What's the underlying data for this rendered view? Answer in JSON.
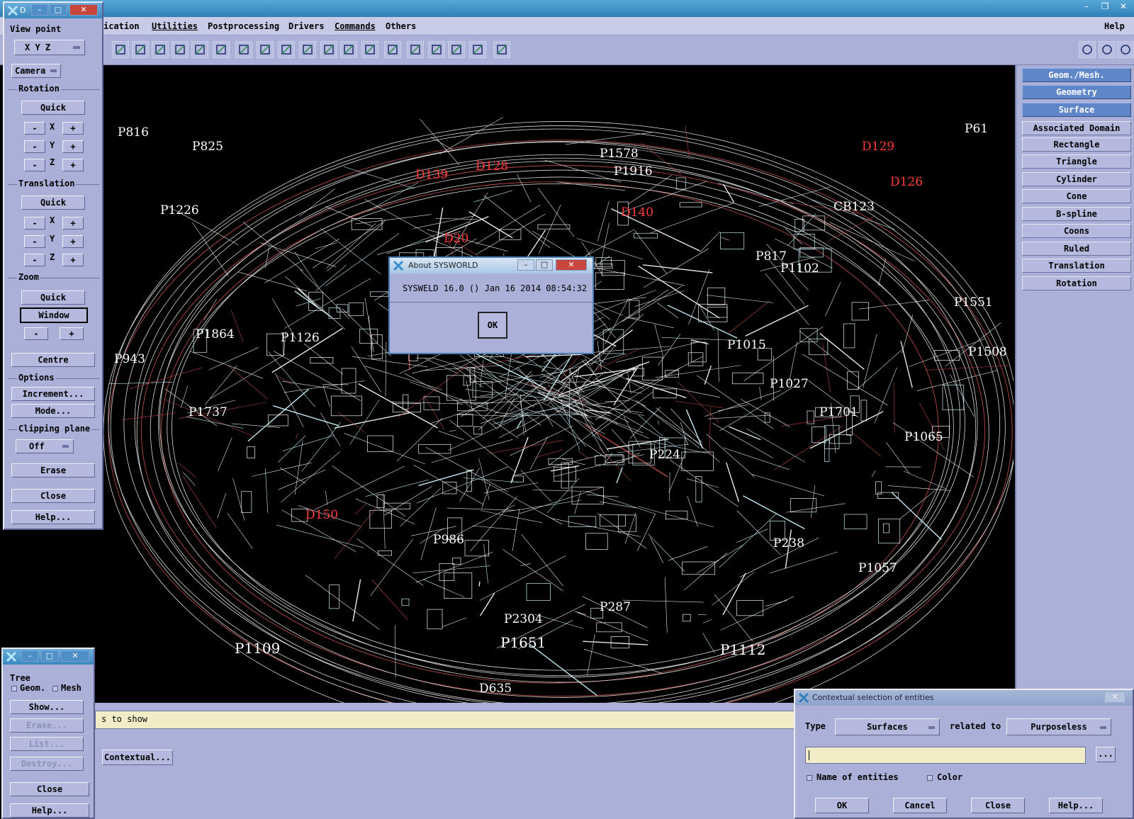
{
  "main_window": {
    "menus": [
      "ication",
      "Utilities",
      "Postprocessing",
      "Drivers",
      "Commands",
      "Others",
      "Help"
    ]
  },
  "view_dialog": {
    "title": "D",
    "view_point_label": "View point",
    "axis_select": "X  Y  Z",
    "camera_select": "Camera",
    "rotation_label": "Rotation",
    "quick_label": "Quick",
    "axis_x": "X",
    "axis_y": "Y",
    "axis_z": "Z",
    "minus": "-",
    "plus": "+",
    "translation_label": "Translation",
    "zoom_label": "Zoom",
    "window_label": "Window",
    "centre_label": "Centre",
    "options_label": "Options",
    "increment_label": "Increment...",
    "mode_label": "Mode...",
    "clipping_label": "Clipping plane",
    "clipping_value": "Off",
    "erase_label": "Erase",
    "close_label": "Close",
    "help_label": "Help..."
  },
  "right_panel": {
    "items": [
      {
        "label": "Geom./Mesh.",
        "selected": true
      },
      {
        "label": "Geometry",
        "selected": true
      },
      {
        "label": "Surface",
        "selected": true
      },
      {
        "label": "Associated Domain",
        "selected": false
      },
      {
        "label": "Rectangle",
        "selected": false
      },
      {
        "label": "Triangle",
        "selected": false
      },
      {
        "label": "Cylinder",
        "selected": false
      },
      {
        "label": "Cone",
        "selected": false
      },
      {
        "label": "B-spline",
        "selected": false
      },
      {
        "label": "Coons",
        "selected": false
      },
      {
        "label": "Ruled",
        "selected": false
      },
      {
        "label": "Translation",
        "selected": false
      },
      {
        "label": "Rotation",
        "selected": false
      }
    ]
  },
  "viewport_labels": [
    {
      "t": "P1109",
      "c": "#ffffff"
    },
    {
      "t": "P1651",
      "c": "#ffffff"
    },
    {
      "t": "P1112",
      "c": "#ffffff"
    },
    {
      "t": "D139",
      "c": "#ff3b3b"
    },
    {
      "t": "D128",
      "c": "#ff3b3b"
    },
    {
      "t": "D140",
      "c": "#ff3b3b"
    },
    {
      "t": "D126",
      "c": "#ff3b3b"
    },
    {
      "t": "D129",
      "c": "#ff3b3b"
    },
    {
      "t": "P1916",
      "c": "#ffffff"
    },
    {
      "t": "P1737",
      "c": "#ffffff"
    },
    {
      "t": "P1015",
      "c": "#ffffff"
    },
    {
      "t": "P1102",
      "c": "#ffffff"
    },
    {
      "t": "P238",
      "c": "#ffffff"
    },
    {
      "t": "P1226",
      "c": "#ffffff"
    },
    {
      "t": "P1065",
      "c": "#ffffff"
    },
    {
      "t": "P61",
      "c": "#ffffff"
    },
    {
      "t": "D20",
      "c": "#ff3b3b"
    },
    {
      "t": "D150",
      "c": "#ff3b3b"
    },
    {
      "t": "P224",
      "c": "#ffffff"
    },
    {
      "t": "P1864",
      "c": "#ffffff"
    },
    {
      "t": "P816",
      "c": "#ffffff"
    },
    {
      "t": "P825",
      "c": "#ffffff"
    },
    {
      "t": "P943",
      "c": "#ffffff"
    },
    {
      "t": "P1508",
      "c": "#ffffff"
    },
    {
      "t": "P1551",
      "c": "#ffffff"
    },
    {
      "t": "P1057",
      "c": "#ffffff"
    },
    {
      "t": "P2304",
      "c": "#ffffff"
    },
    {
      "t": "P287",
      "c": "#ffffff"
    },
    {
      "t": "P986",
      "c": "#ffffff"
    },
    {
      "t": "P817",
      "c": "#ffffff"
    },
    {
      "t": "P1027",
      "c": "#ffffff"
    },
    {
      "t": "P1701",
      "c": "#ffffff"
    },
    {
      "t": "P1578",
      "c": "#ffffff"
    },
    {
      "t": "CB123",
      "c": "#ffffff"
    },
    {
      "t": "P1126",
      "c": "#ffffff"
    },
    {
      "t": "D635",
      "c": "#ffffff"
    }
  ],
  "about_dialog": {
    "title": "About SYSWORLD",
    "message": "SYSWELD 16.0 () Jan 16 2014 08:54:32",
    "ok": "OK"
  },
  "tree_dialog": {
    "label": "Tree",
    "geom_label": "Geom.",
    "mesh_label": "Mesh",
    "show": "Show...",
    "erase": "Erase...",
    "list": "List...",
    "destroy": "Destroy...",
    "close": "Close",
    "help": "Help..."
  },
  "command_line": {
    "text": "s to show"
  },
  "contextual_button": "Contextual...",
  "contextual_dialog": {
    "title": "Contextual selection of entities",
    "type_label": "Type",
    "type_value": "Surfaces",
    "related_label": "related to",
    "related_value": "Purposeless",
    "input_value": "",
    "more": "...",
    "name_entities": "Name of entities",
    "color": "Color",
    "ok": "OK",
    "cancel": "Cancel",
    "close": "Close",
    "help": "Help..."
  }
}
